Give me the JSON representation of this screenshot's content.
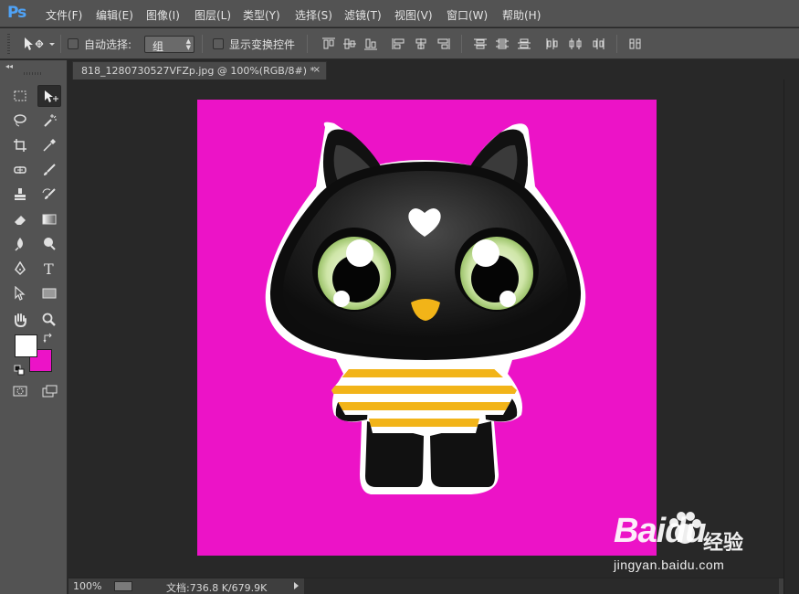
{
  "app": {
    "logo_text": "Ps"
  },
  "menu": [
    {
      "label": "文件(F)"
    },
    {
      "label": "编辑(E)"
    },
    {
      "label": "图像(I)"
    },
    {
      "label": "图层(L)"
    },
    {
      "label": "类型(Y)"
    },
    {
      "label": "选择(S)"
    },
    {
      "label": "滤镜(T)"
    },
    {
      "label": "视图(V)"
    },
    {
      "label": "窗口(W)"
    },
    {
      "label": "帮助(H)"
    }
  ],
  "options": {
    "auto_select_label": "自动选择:",
    "auto_select_checked": false,
    "group_value": "组",
    "show_transform_label": "显示变换控件",
    "show_transform_checked": false
  },
  "document": {
    "tab_title": "818_1280730527VFZp.jpg @ 100%(RGB/8#) *",
    "close_glyph": "×",
    "canvas_color": "#ec13c7"
  },
  "colors": {
    "foreground": "#ffffff",
    "background": "#ec13c7"
  },
  "status": {
    "zoom": "100%",
    "doc_info": "文档:736.8 K/679.9K"
  },
  "watermark": {
    "brand": "Baidu",
    "cn": "经验",
    "url": "jingyan.baidu.com"
  }
}
